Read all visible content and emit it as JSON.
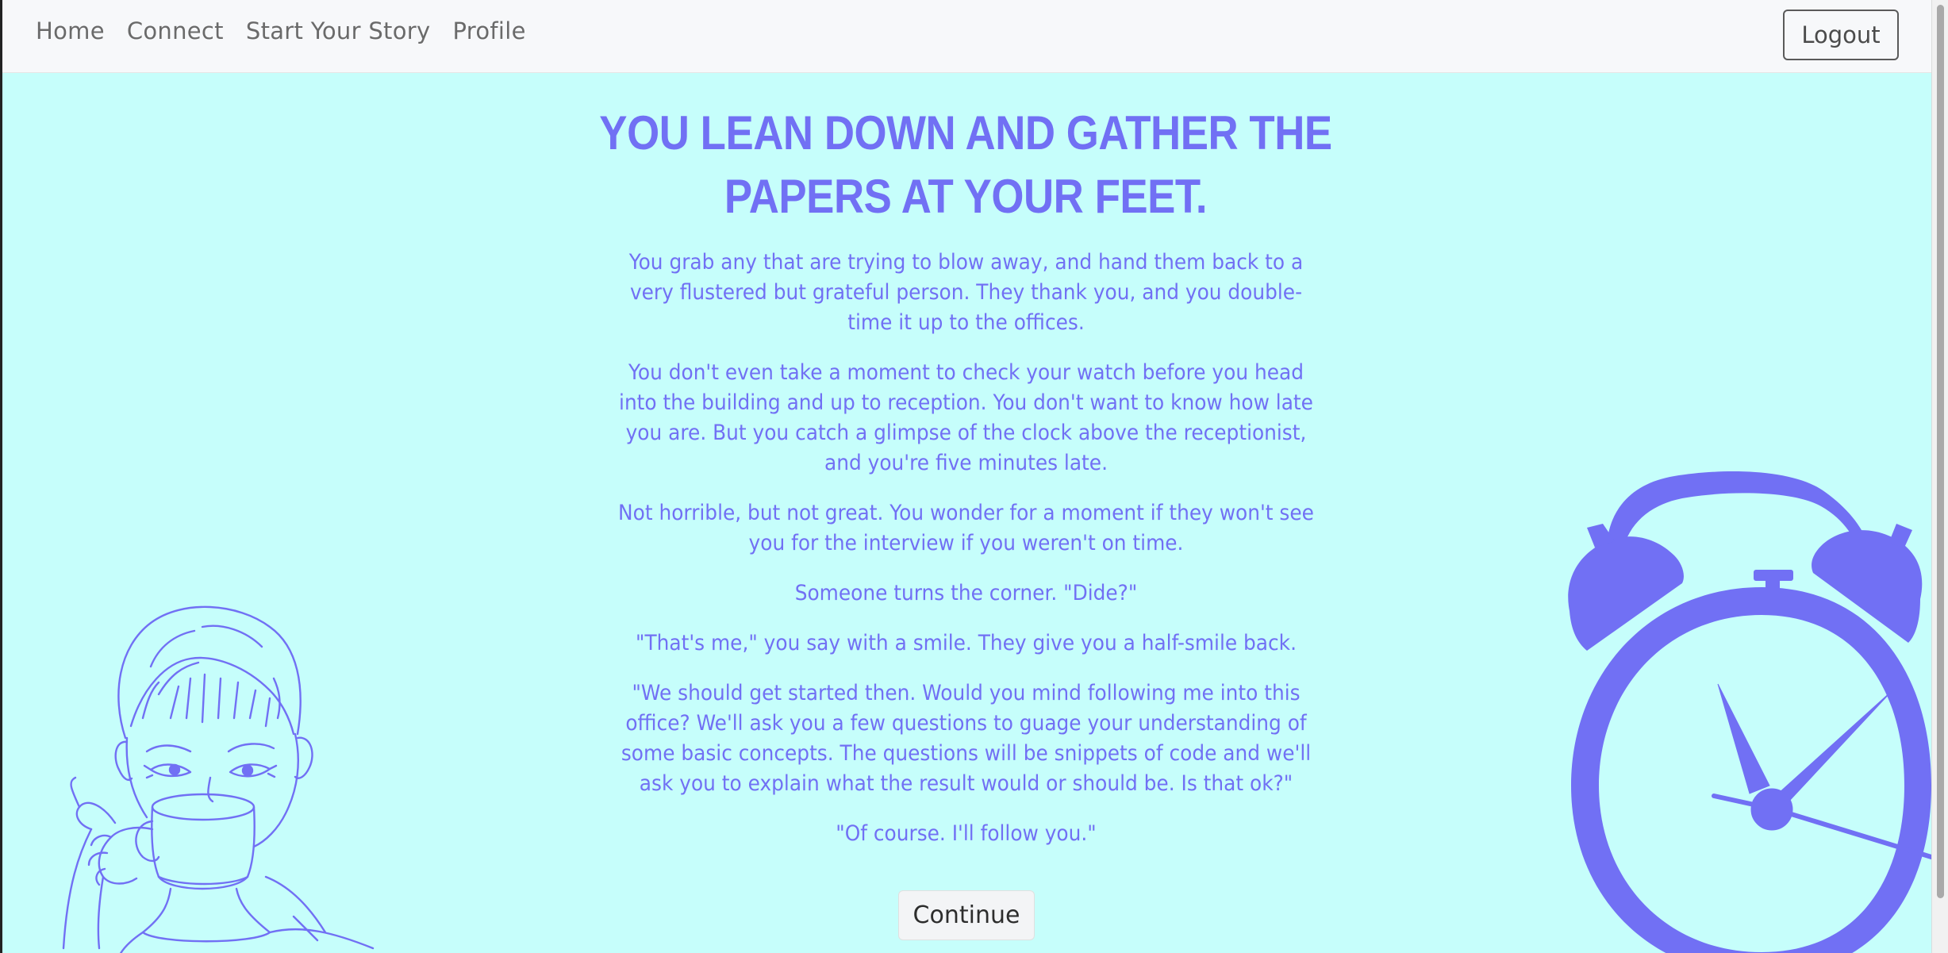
{
  "nav": {
    "links": [
      "Home",
      "Connect",
      "Start Your Story",
      "Profile"
    ],
    "logout_label": "Logout"
  },
  "story": {
    "title": "You lean down and gather the papers at your feet.",
    "paragraphs": [
      "You grab any that are trying to blow away, and hand them back to a very flustered but grateful person. They thank you, and you double-time it up to the offices.",
      "You don't even take a moment to check your watch before you head into the building and up to reception. You don't want to know how late you are. But you catch a glimpse of the clock above the receptionist, and you're five minutes late.",
      "Not horrible, but not great. You wonder for a moment if they won't see you for the interview if you weren't on time.",
      "Someone turns the corner. \"Dide?\"",
      "\"That's me,\" you say with a smile. They give you a half-smile back.",
      "\"We should get started then. Would you mind following me into this office? We'll ask you a few questions to guage your understanding of some basic concepts. The questions will be snippets of code and we'll ask you to explain what the result would or should be. Is that ok?\"",
      "\"Of course. I'll follow you.\""
    ],
    "continue_label": "Continue"
  },
  "colors": {
    "background": "#c6fefb",
    "accent": "#7170f4",
    "navbar": "#f7f8fa"
  },
  "icons": {
    "left_illustration": "woman-drinking-coffee-illustration",
    "right_illustration": "alarm-clock-illustration"
  }
}
